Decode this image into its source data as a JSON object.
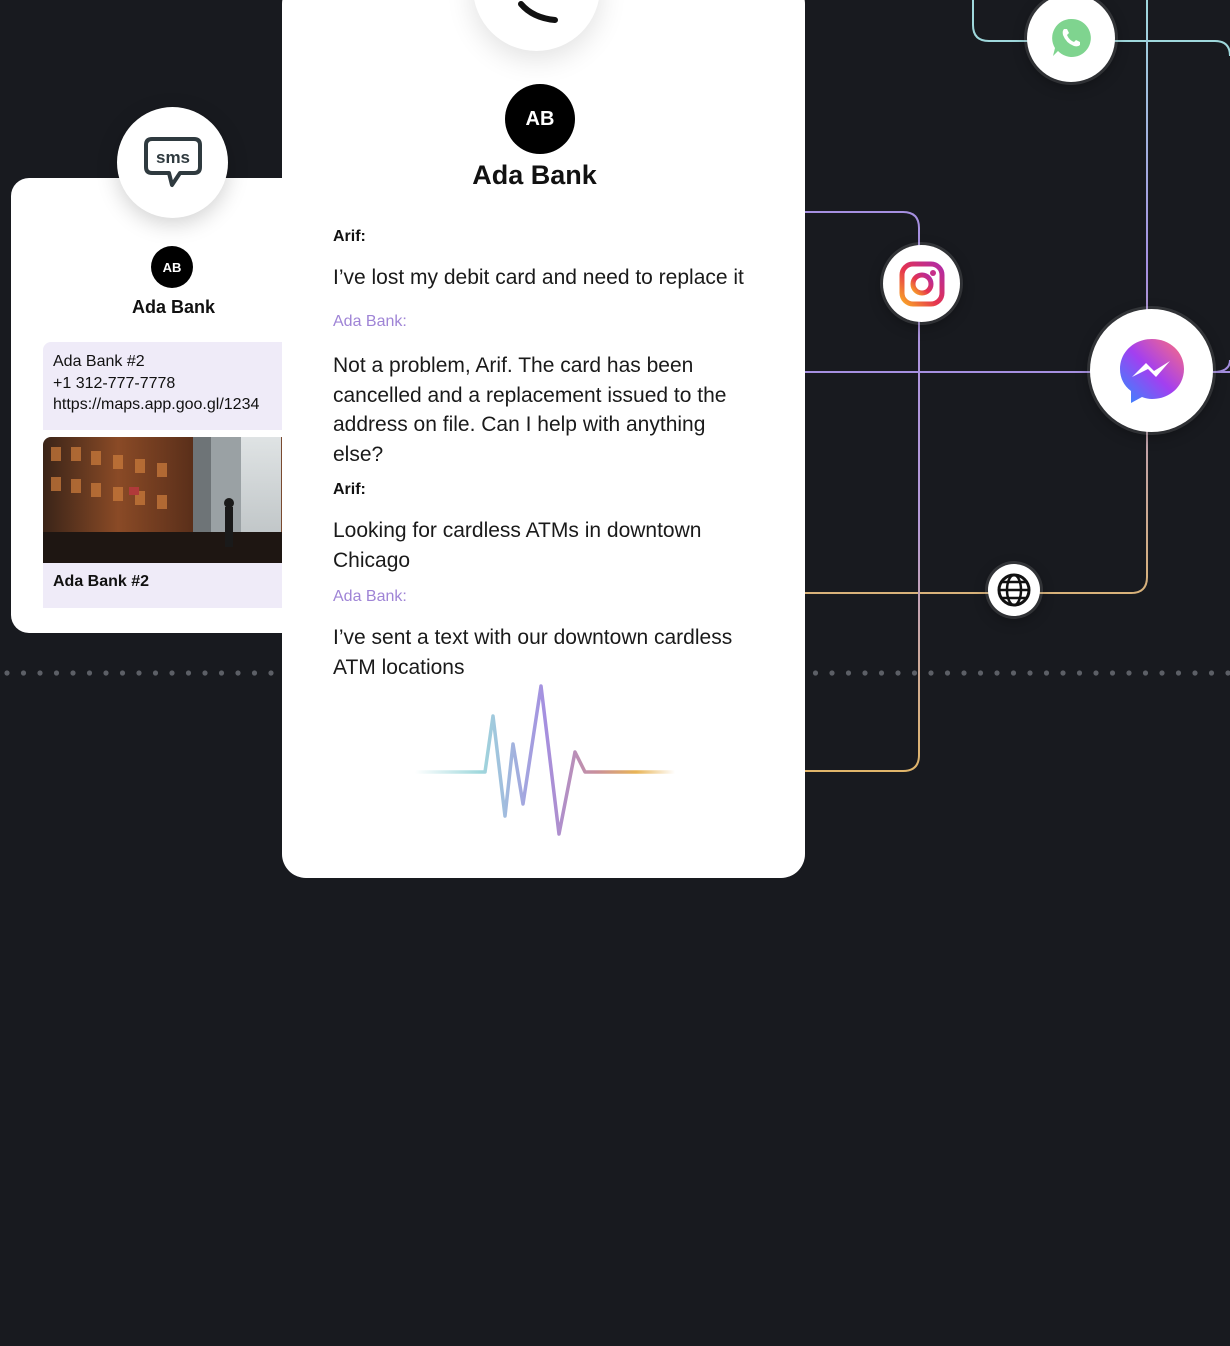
{
  "colors": {
    "background": "#181a1f",
    "card": "#ffffff",
    "bubble": "#efebf8",
    "bot_name": "#9f84d6",
    "line_teal": "#9fd8dc",
    "line_violet": "#a58fe0",
    "line_gold": "#d8b27a"
  },
  "sms_card": {
    "icon": "sms-speech-bubble-icon",
    "icon_text": "sms",
    "avatar_initials": "AB",
    "title": "Ada Bank",
    "bubble_lines": [
      "Ada Bank #2",
      "+1 312-777-7778",
      "https://maps.app.goo.gl/1234"
    ],
    "photo_caption": "Ada Bank #2"
  },
  "main_card": {
    "avatar_initials": "AB",
    "title": "Ada Bank",
    "messages": [
      {
        "sender": "Arif:",
        "text": "I’ve lost my debit card and need to replace it"
      },
      {
        "sender": "Ada Bank:",
        "text": "Not a problem, Arif. The card has been cancelled and a replacement issued to the address on file. Can I help with anything else?"
      },
      {
        "sender": "Arif:",
        "text": "Looking for cardless ATMs in downtown Chicago"
      },
      {
        "sender": "Ada Bank:",
        "text": "I’ve sent a text with our downtown cardless ATM locations"
      }
    ],
    "waveform_icon": "voice-waveform-icon",
    "top_icon": "phone-icon"
  },
  "channels": [
    "whatsapp-icon",
    "instagram-icon",
    "messenger-icon",
    "globe-icon"
  ]
}
